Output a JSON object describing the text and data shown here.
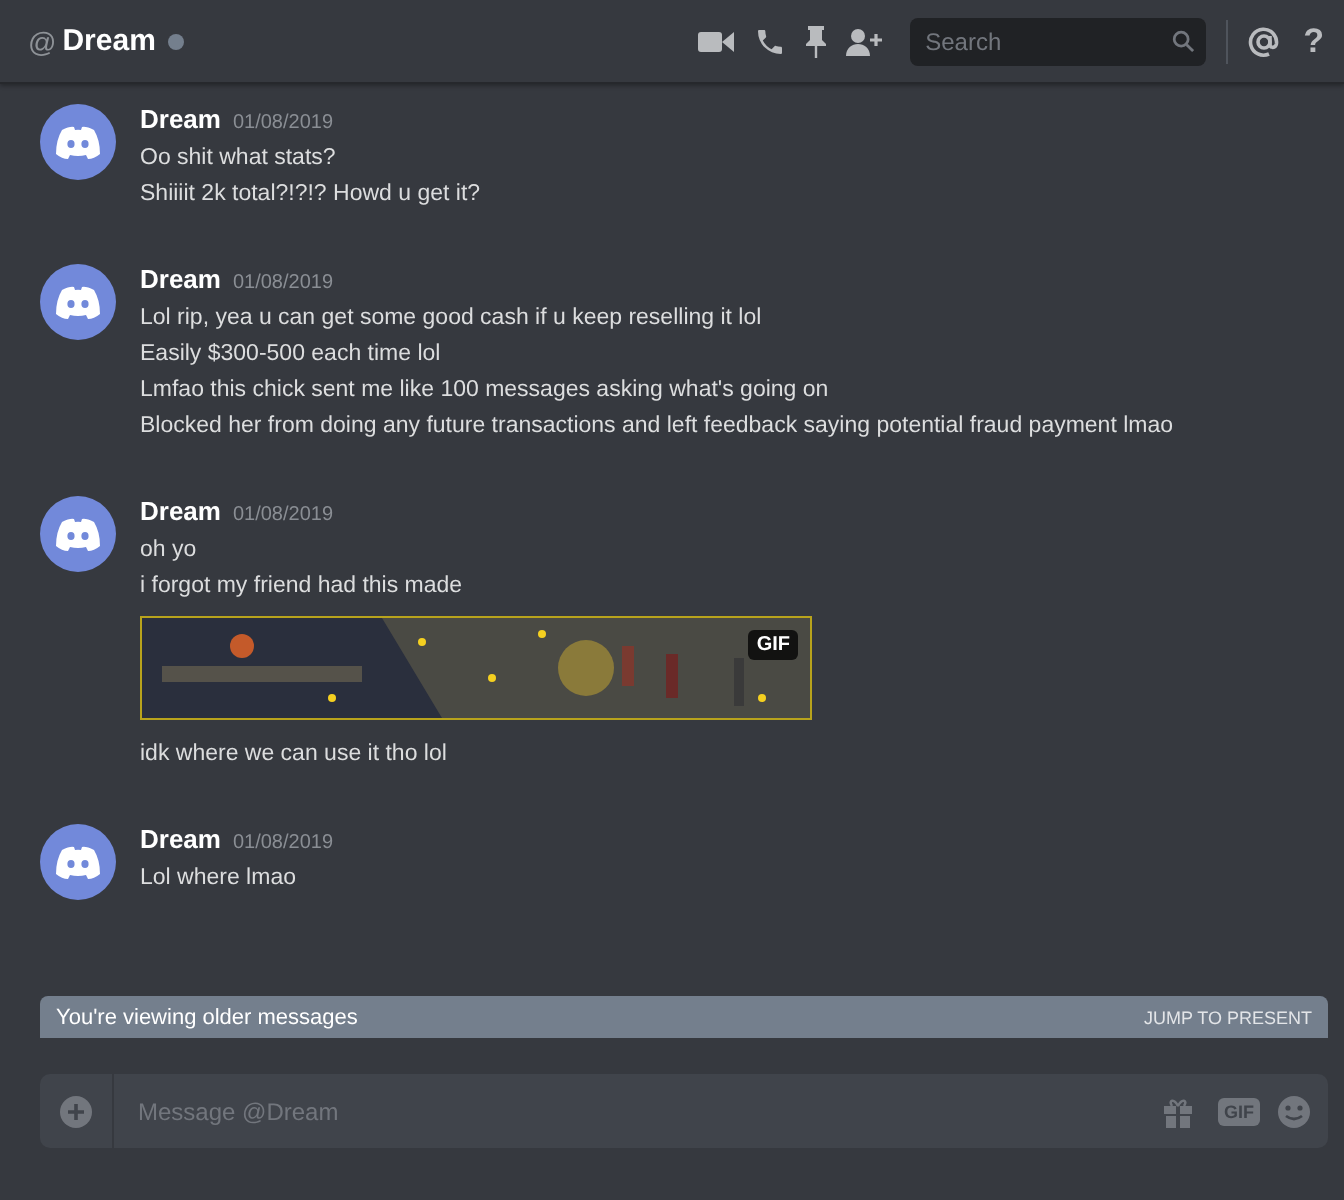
{
  "header": {
    "at": "@",
    "name": "Dream",
    "online": false,
    "search": {
      "placeholder": "Search"
    },
    "help": "?"
  },
  "messages": [
    {
      "author": "Dream",
      "time": "01/08/2019",
      "items": [
        {
          "kind": "text",
          "text": "Oo shit what stats?"
        },
        {
          "kind": "text",
          "text": "Shiiiit 2k total?!?!? Howd u get it?"
        }
      ]
    },
    {
      "author": "Dream",
      "time": "01/08/2019",
      "items": [
        {
          "kind": "text",
          "text": "Lol rip, yea u can get some good cash if u keep reselling it lol"
        },
        {
          "kind": "text",
          "text": "Easily $300-500 each time lol"
        },
        {
          "kind": "text",
          "text": "Lmfao this chick sent me like 100 messages asking what's going on"
        },
        {
          "kind": "text",
          "text": "Blocked her from doing any future transactions and left feedback saying potential fraud payment lmao"
        }
      ]
    },
    {
      "author": "Dream",
      "time": "01/08/2019",
      "items": [
        {
          "kind": "text",
          "text": "oh yo"
        },
        {
          "kind": "text",
          "text": "i forgot my friend had this made"
        },
        {
          "kind": "gif",
          "badge": "GIF"
        },
        {
          "kind": "text",
          "text": "idk where we can use it tho lol"
        }
      ]
    },
    {
      "author": "Dream",
      "time": "01/08/2019",
      "items": [
        {
          "kind": "text",
          "text": "Lol where lmao"
        }
      ]
    }
  ],
  "older_bar": {
    "text": "You're viewing older messages",
    "action": "JUMP TO PRESENT"
  },
  "composer": {
    "placeholder": "Message @Dream",
    "gif": "GIF"
  }
}
